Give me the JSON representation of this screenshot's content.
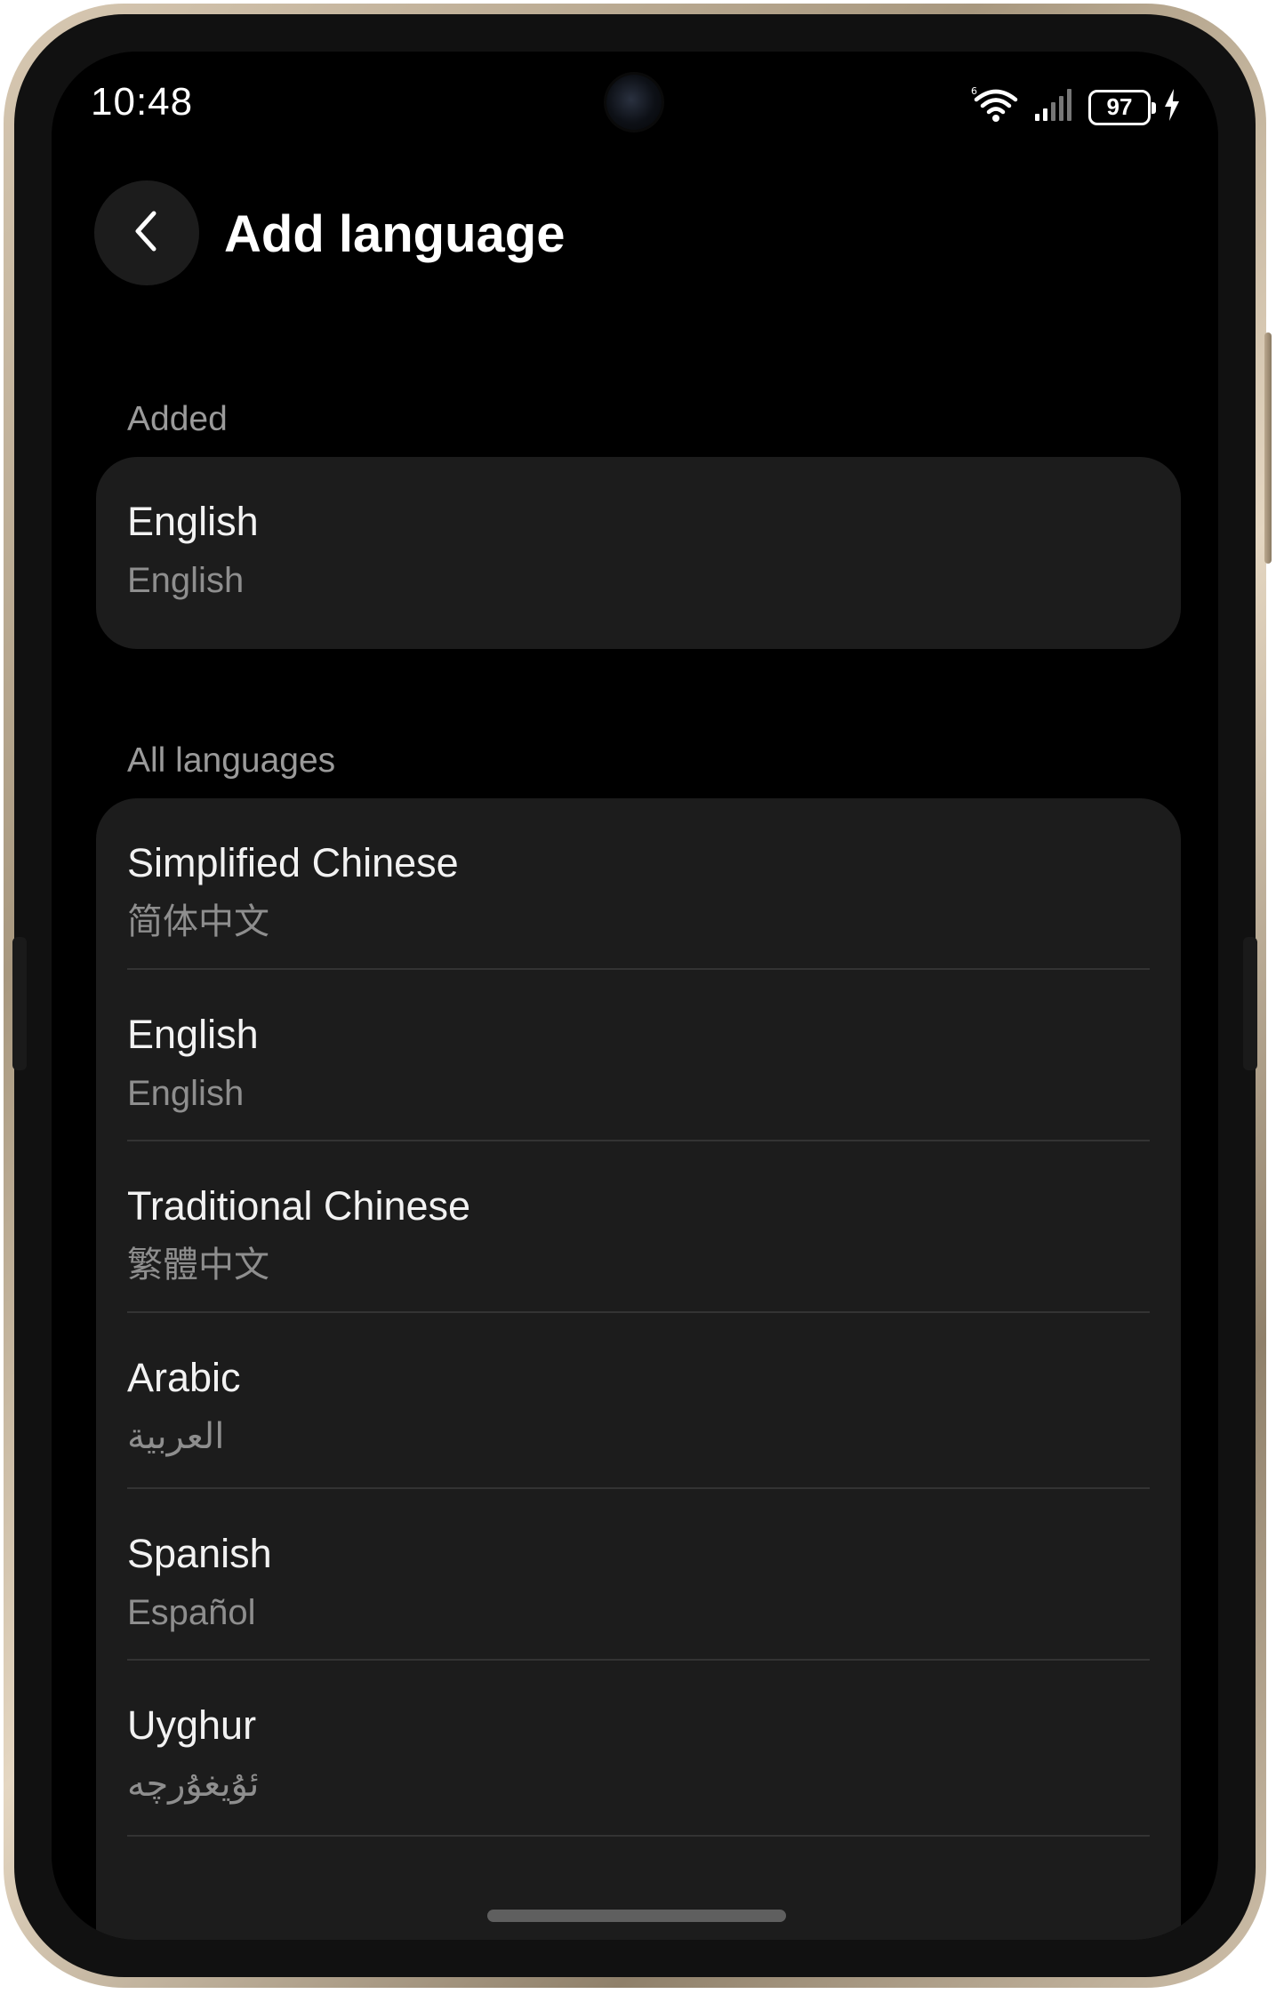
{
  "status_bar": {
    "time": "10:48",
    "battery": "97",
    "icons": [
      "wifi-icon",
      "signal-icon",
      "battery-icon",
      "charging-icon"
    ]
  },
  "header": {
    "title": "Add language",
    "back_icon": "chevron-left-icon"
  },
  "added": {
    "label": "Added",
    "items": [
      {
        "name": "English",
        "native": "English"
      }
    ]
  },
  "all_languages": {
    "label": "All languages",
    "items": [
      {
        "name": "Simplified Chinese",
        "native": "简体中文"
      },
      {
        "name": "English",
        "native": "English"
      },
      {
        "name": "Traditional Chinese",
        "native": "繁體中文"
      },
      {
        "name": "Arabic",
        "native": "العربية"
      },
      {
        "name": "Spanish",
        "native": "Español"
      },
      {
        "name": "Uyghur",
        "native": "ئۇيغۇرچە"
      }
    ]
  },
  "colors": {
    "background": "#000000",
    "card": "#1c1c1c",
    "primary_text": "#f2f2f2",
    "secondary_text": "#8e8e8e"
  }
}
